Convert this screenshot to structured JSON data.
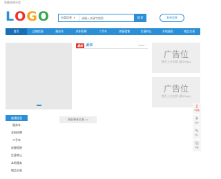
{
  "topbar": {
    "text": "答题说明分类"
  },
  "logo": {
    "letters": [
      "L",
      "O",
      "G",
      "O"
    ],
    "colors": [
      "#2a8fd6",
      "#e8352b",
      "#f5a623",
      "#3aa655"
    ]
  },
  "search": {
    "category": "分类信息",
    "placeholder": "请输入关键字搜索",
    "button": "搜 索"
  },
  "post_button": "发布信息",
  "nav": {
    "items": [
      "首页",
      "店铺信息",
      "服务车",
      "求职招聘",
      "二手车",
      "房屋租售",
      "生意转让",
      "本地服务",
      "物品交易"
    ],
    "active_index": 0
  },
  "latest": {
    "badge": "最新",
    "title": "发布",
    "more": "MORE >"
  },
  "ads": [
    {
      "title": "广告位",
      "sub": "首页上方右侧 (宽300px)"
    },
    {
      "title": "广告位",
      "sub": "首页上方右侧 (宽300px)"
    }
  ],
  "categories": {
    "header": "普通信息",
    "items": [
      "服务车",
      "求职招聘",
      "二手车",
      "房屋租售",
      "生意转让",
      "本地服务",
      "物品交易"
    ]
  },
  "load_more": "获取更多信息 >>",
  "side_toolbar": [
    {
      "glyph": "▯",
      "label": "手机版"
    },
    {
      "glyph": "✈",
      "label": "发布"
    },
    {
      "glyph": "✎",
      "label": "留言"
    },
    {
      "glyph": "☏",
      "label": "客服"
    }
  ]
}
